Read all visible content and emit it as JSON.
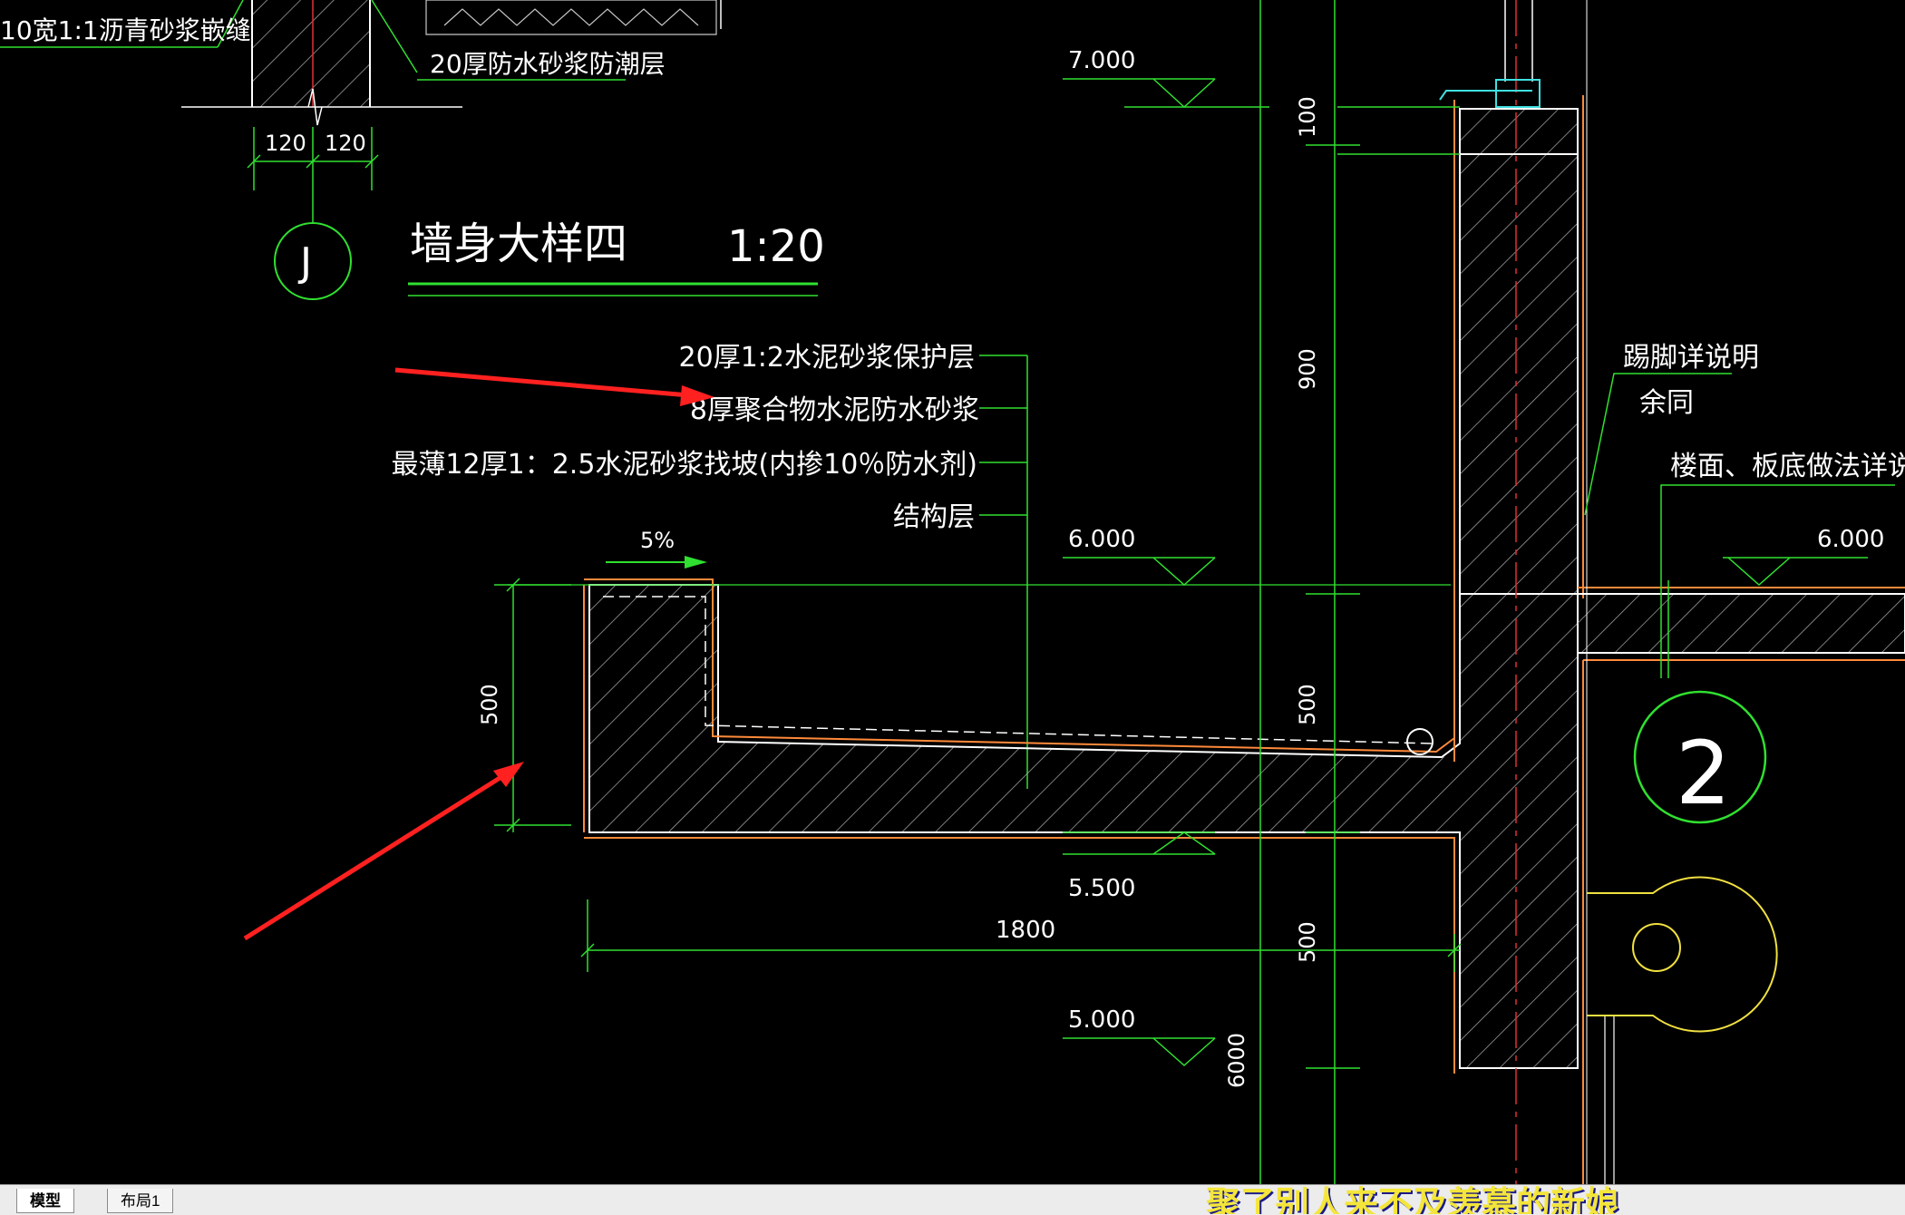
{
  "drawing": {
    "top_note_left": "10宽1:1沥青砂浆嵌缝",
    "top_note_mid": "20厚防水砂浆防潮层",
    "dim_120a": "120",
    "dim_120b": "120",
    "axis_j": "J",
    "detail_title": "墙身大样四",
    "detail_scale": "1:20",
    "layer_1": "20厚1:2水泥砂浆保护层",
    "layer_2": "8厚聚合物水泥防水砂浆",
    "layer_3": "最薄12厚1：2.5水泥砂浆找坡(内掺10％防水剂)",
    "layer_4": "结构层",
    "slope": "5%",
    "elev_7000": "7.000",
    "elev_6000_left": "6.000",
    "elev_6000_right": "6.000",
    "elev_5500": "5.500",
    "elev_5000": "5.000",
    "dim_100": "100",
    "dim_900": "900",
    "dim_500_v1": "500",
    "dim_500_v2": "500",
    "dim_500_left": "500",
    "dim_6000": "6000",
    "dim_1800": "1800",
    "note_skirting": "踢脚详说明",
    "note_same": "余同",
    "note_floor": "楼面、板底做法详说明",
    "axis_2": "2"
  },
  "tabs": {
    "model": "模型",
    "layout1": "布局1"
  },
  "overlay_text": "聚了别人来不及羡慕的新娘"
}
